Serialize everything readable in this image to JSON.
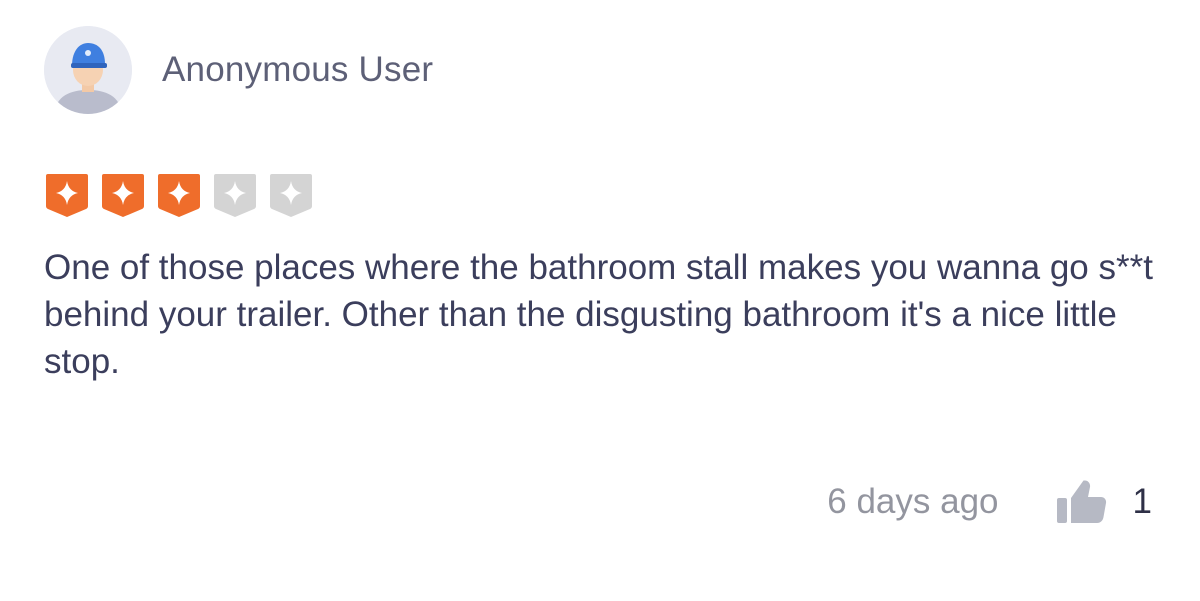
{
  "review": {
    "author": "Anonymous User",
    "avatar_icon": "user-avatar-icon",
    "rating": {
      "value": 3,
      "max": 5,
      "filled_color": "#ef6d2b",
      "empty_color": "#d4d4d4",
      "icon": "star-badge-icon"
    },
    "text": "One of those places where the bathroom stall makes you wanna go s**t behind your trailer. Other than the disgusting bathroom it's a nice little stop.",
    "timestamp": "6 days ago",
    "likes": {
      "icon": "thumbs-up-icon",
      "count": "1"
    }
  }
}
